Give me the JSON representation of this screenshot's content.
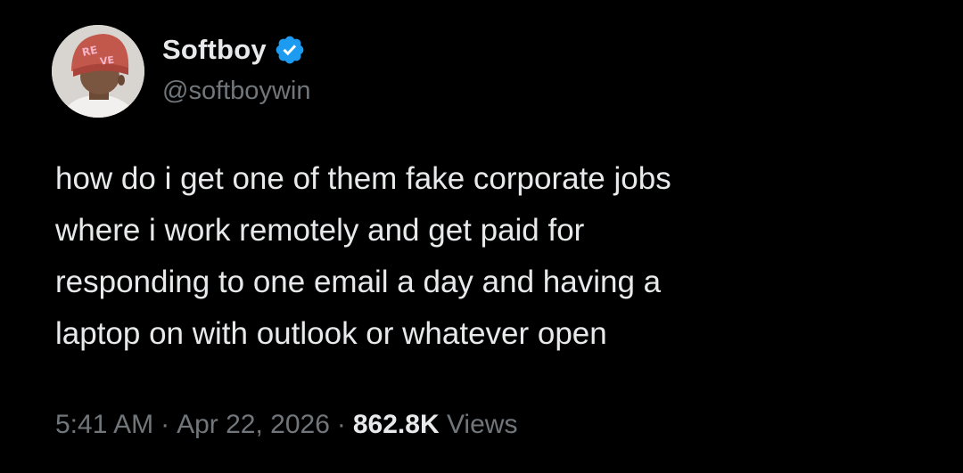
{
  "author": {
    "display_name": "Softboy",
    "handle": "@softboywin",
    "verified": true,
    "verified_icon": "verified-badge-icon",
    "verified_color": "#1d9bf0"
  },
  "tweet": {
    "text": "how do i get one of them fake corporate jobs\nwhere i work remotely and get paid for\nresponding to one email a day and having a\nlaptop on with outlook or whatever open",
    "time": "5:41 AM",
    "separator": "·",
    "date": "Apr 22, 2026",
    "views_count": "862.8K",
    "views_label": "Views"
  },
  "colors": {
    "background": "#000000",
    "primary_text": "#e7e9ea",
    "secondary_text": "#71767b"
  }
}
